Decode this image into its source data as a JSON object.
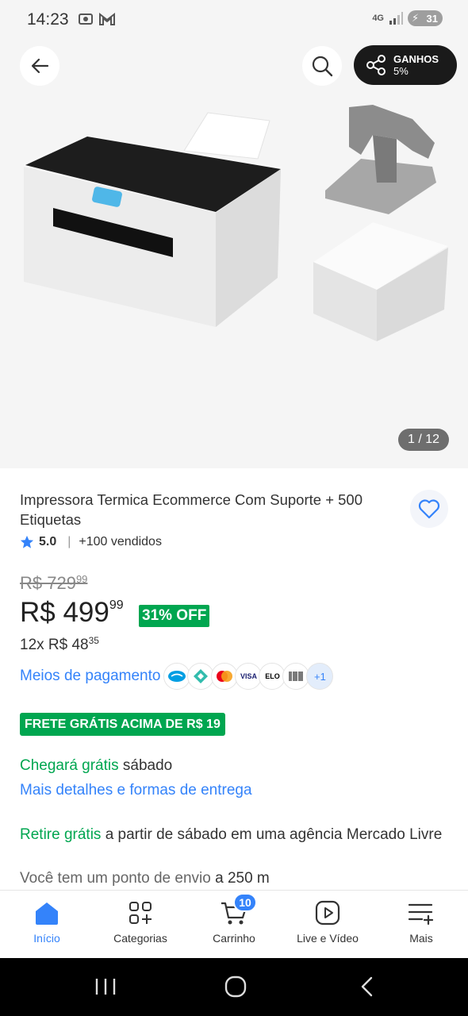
{
  "status_bar": {
    "time": "14:23",
    "network": "4G",
    "battery": "31",
    "colors": {
      "background": "#f5f5f5",
      "battery": "#9e9e9e"
    }
  },
  "gallery": {
    "share_button": {
      "label": "GANHOS",
      "percent": "5%"
    },
    "counter": "1 / 12",
    "icons": [
      "back-arrow-icon",
      "search-icon",
      "share-icon"
    ]
  },
  "product": {
    "title": "Impressora Termica Ecommerce Com Suporte + 500 Etiquetas",
    "rating": "5.0",
    "sold": "+100 vendidos",
    "old_price": {
      "main": "R$ 729",
      "cents": "99"
    },
    "price": {
      "main": "R$ 499",
      "cents": "99"
    },
    "discount": "31% OFF",
    "installments": {
      "main": "12x R$ 48",
      "cents": "35"
    },
    "payment_link": "Meios de pagamento",
    "payment_methods": [
      "Mercado Pago",
      "Pix",
      "Mastercard",
      "VISA",
      "ELO",
      "Boleto"
    ],
    "payment_more": "+1",
    "free_shipping": "FRETE GRÁTIS ACIMA DE R$ 19",
    "arrival": {
      "highlight": "Chegará grátis",
      "rest": "sábado"
    },
    "delivery_link": "Mais detalhes e formas de entrega",
    "pickup": {
      "highlight": "Retire grátis",
      "rest": "a partir de sábado em uma agência Mercado Livre"
    },
    "point": {
      "text": "Você tem um ponto de envio",
      "distance": "a 250 m"
    }
  },
  "bottom_nav": {
    "items": [
      {
        "label": "Início",
        "icon": "home-icon",
        "active": true
      },
      {
        "label": "Categorias",
        "icon": "categories-icon"
      },
      {
        "label": "Carrinho",
        "icon": "cart-icon",
        "badge": "10"
      },
      {
        "label": "Live e Vídeo",
        "icon": "play-icon"
      },
      {
        "label": "Mais",
        "icon": "menu-plus-icon"
      }
    ]
  },
  "colors": {
    "accent_blue": "#3483fa",
    "accent_green": "#00a650",
    "text": "#333333"
  }
}
